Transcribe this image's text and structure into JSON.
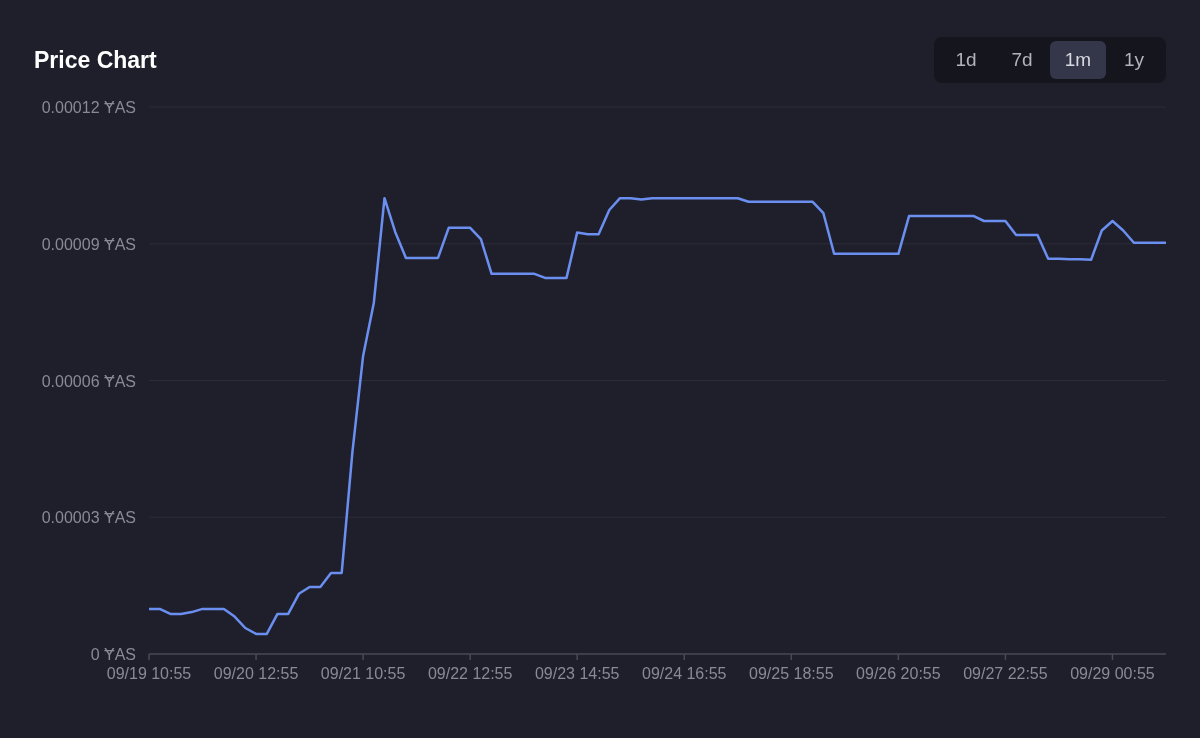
{
  "title": "Price Chart",
  "range_buttons": [
    {
      "label": "1d",
      "selected": false
    },
    {
      "label": "7d",
      "selected": false
    },
    {
      "label": "1m",
      "selected": true
    },
    {
      "label": "1y",
      "selected": false
    }
  ],
  "chart_data": {
    "type": "line",
    "categories": [
      "09/19 10:55",
      null,
      null,
      null,
      null,
      null,
      null,
      null,
      null,
      null,
      "09/20 12:55",
      null,
      null,
      null,
      null,
      null,
      null,
      null,
      null,
      null,
      "09/21 10:55",
      null,
      null,
      null,
      null,
      null,
      null,
      null,
      null,
      null,
      "09/22 12:55",
      null,
      null,
      null,
      null,
      null,
      null,
      null,
      null,
      null,
      "09/23 14:55",
      null,
      null,
      null,
      null,
      null,
      null,
      null,
      null,
      null,
      "09/24 16:55",
      null,
      null,
      null,
      null,
      null,
      null,
      null,
      null,
      null,
      "09/25 18:55",
      null,
      null,
      null,
      null,
      null,
      null,
      null,
      null,
      null,
      "09/26 20:55",
      null,
      null,
      null,
      null,
      null,
      null,
      null,
      null,
      null,
      "09/27 22:55",
      null,
      null,
      null,
      null,
      null,
      null,
      null,
      null,
      null,
      "09/29 00:55",
      null,
      null,
      null,
      null,
      null
    ],
    "series": [
      {
        "color": "#6b8ff0",
        "values": [
          9.9e-06,
          9.9e-06,
          8.8e-06,
          8.8e-06,
          9.2e-06,
          9.9e-06,
          9.9e-06,
          9.9e-06,
          8.2e-06,
          5.7e-06,
          4.4e-06,
          4.4e-06,
          8.8e-06,
          8.8e-06,
          1.32e-05,
          1.47e-05,
          1.47e-05,
          1.78e-05,
          1.78e-05,
          4.43e-05,
          6.54e-05,
          7.7e-05,
          0.0001,
          9.26e-05,
          8.69e-05,
          8.69e-05,
          8.69e-05,
          8.69e-05,
          9.35e-05,
          9.35e-05,
          9.35e-05,
          9.1e-05,
          8.34e-05,
          8.34e-05,
          8.34e-05,
          8.34e-05,
          8.34e-05,
          8.25e-05,
          8.25e-05,
          8.25e-05,
          9.25e-05,
          9.21e-05,
          9.21e-05,
          9.74e-05,
          0.0001,
          0.0001,
          9.97e-05,
          0.0001,
          0.0001,
          0.0001,
          0.0001,
          0.0001,
          0.0001,
          0.0001,
          0.0001,
          0.0001,
          9.92e-05,
          9.92e-05,
          9.92e-05,
          9.92e-05,
          9.92e-05,
          9.92e-05,
          9.92e-05,
          9.67e-05,
          8.78e-05,
          8.78e-05,
          8.78e-05,
          8.78e-05,
          8.78e-05,
          8.78e-05,
          8.78e-05,
          9.61e-05,
          9.61e-05,
          9.61e-05,
          9.61e-05,
          9.61e-05,
          9.61e-05,
          9.61e-05,
          9.5e-05,
          9.5e-05,
          9.5e-05,
          9.19e-05,
          9.19e-05,
          9.19e-05,
          8.67e-05,
          8.67e-05,
          8.66e-05,
          8.66e-05,
          8.65e-05,
          9.29e-05,
          9.5e-05,
          9.29e-05,
          9.02e-05,
          9.02e-05,
          9.02e-05,
          9.02e-05
        ]
      }
    ],
    "grid": true,
    "ylim": [
      0,
      0.00012
    ],
    "yticks": [
      {
        "value": 0,
        "label": "0 ɎAS"
      },
      {
        "value": 3e-05,
        "label": "0.00003 ɎAS"
      },
      {
        "value": 6e-05,
        "label": "0.00006 ɎAS"
      },
      {
        "value": 9e-05,
        "label": "0.00009 ɎAS"
      },
      {
        "value": 0.00012,
        "label": "0.00012 ɎAS"
      }
    ]
  }
}
